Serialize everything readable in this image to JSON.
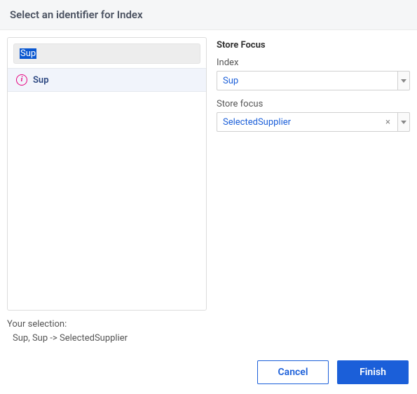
{
  "header": {
    "title": "Select an identifier for Index"
  },
  "search": {
    "value": "Sup"
  },
  "results": [
    {
      "label": "Sup",
      "icon": "info"
    }
  ],
  "form": {
    "section_title": "Store Focus",
    "index": {
      "label": "Index",
      "value": "Sup"
    },
    "store_focus": {
      "label": "Store focus",
      "value": "SelectedSupplier"
    }
  },
  "summary": {
    "title": "Your selection:",
    "detail": "Sup, Sup -> SelectedSupplier"
  },
  "footer": {
    "cancel": "Cancel",
    "finish": "Finish"
  }
}
